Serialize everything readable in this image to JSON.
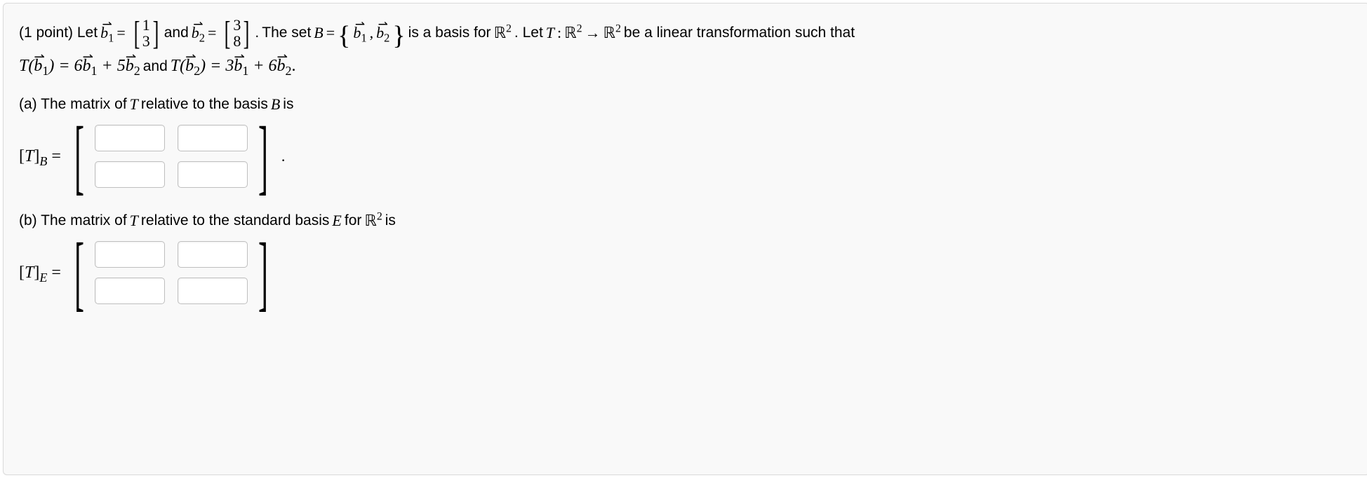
{
  "problem": {
    "points_prefix": "(1 point) Let ",
    "b1_label": "b",
    "b1_sub": "1",
    "eq": " = ",
    "b1_vec_top": "1",
    "b1_vec_bot": "3",
    "and_text": " and ",
    "b2_label": "b",
    "b2_sub": "2",
    "b2_vec_top": "3",
    "b2_vec_bot": "8",
    "period_space": ". ",
    "set_text_1": "The set ",
    "B_sym": "B",
    "set_eq": " = ",
    "brace_l": "{",
    "brace_r": "}",
    "comma": ", ",
    "basis_text_1": " is a basis for ",
    "R": "ℝ",
    "sup2": "2",
    "let_T_text": ". Let ",
    "T_sym": "T",
    "colon": " : ",
    "arrow": " → ",
    "trans_text": " be a linear transformation such that",
    "line2_a": "T(",
    "line2_cb": ") = 6",
    "line2_p5": " + 5",
    "line2_and": " and ",
    "line2_cb2": ") = 3",
    "line2_p6": " + 6",
    "line2_end": "."
  },
  "part_a": {
    "label": "(a) The matrix of ",
    "T": "T",
    "mid": " relative to the basis ",
    "B": "B",
    "end": " is",
    "lhs1": "[",
    "lhs_T": "T",
    "lhs2": "]",
    "lhs_sub": "B",
    "eq": " ="
  },
  "part_b": {
    "label": "(b) The matrix of ",
    "T": "T",
    "mid": " relative to the standard basis ",
    "E": "E",
    "for": " for ",
    "R": "ℝ",
    "sup2": "2",
    "end": " is",
    "lhs1": "[",
    "lhs_T": "T",
    "lhs2": "]",
    "lhs_sub": "E",
    "eq": " ="
  },
  "inputs": {
    "a11": "",
    "a12": "",
    "a21": "",
    "a22": "",
    "b11": "",
    "b12": "",
    "b21": "",
    "b22": ""
  },
  "chart_data": {
    "type": "table",
    "title": "Linear transformation matrices input",
    "b1": [
      1,
      3
    ],
    "b2": [
      3,
      8
    ],
    "T_b1_coeffs": {
      "b1": 6,
      "b2": 5
    },
    "T_b2_coeffs": {
      "b1": 3,
      "b2": 6
    },
    "matrix_B_inputs": [
      [
        "",
        ""
      ],
      [
        "",
        ""
      ]
    ],
    "matrix_E_inputs": [
      [
        "",
        ""
      ],
      [
        "",
        ""
      ]
    ]
  }
}
